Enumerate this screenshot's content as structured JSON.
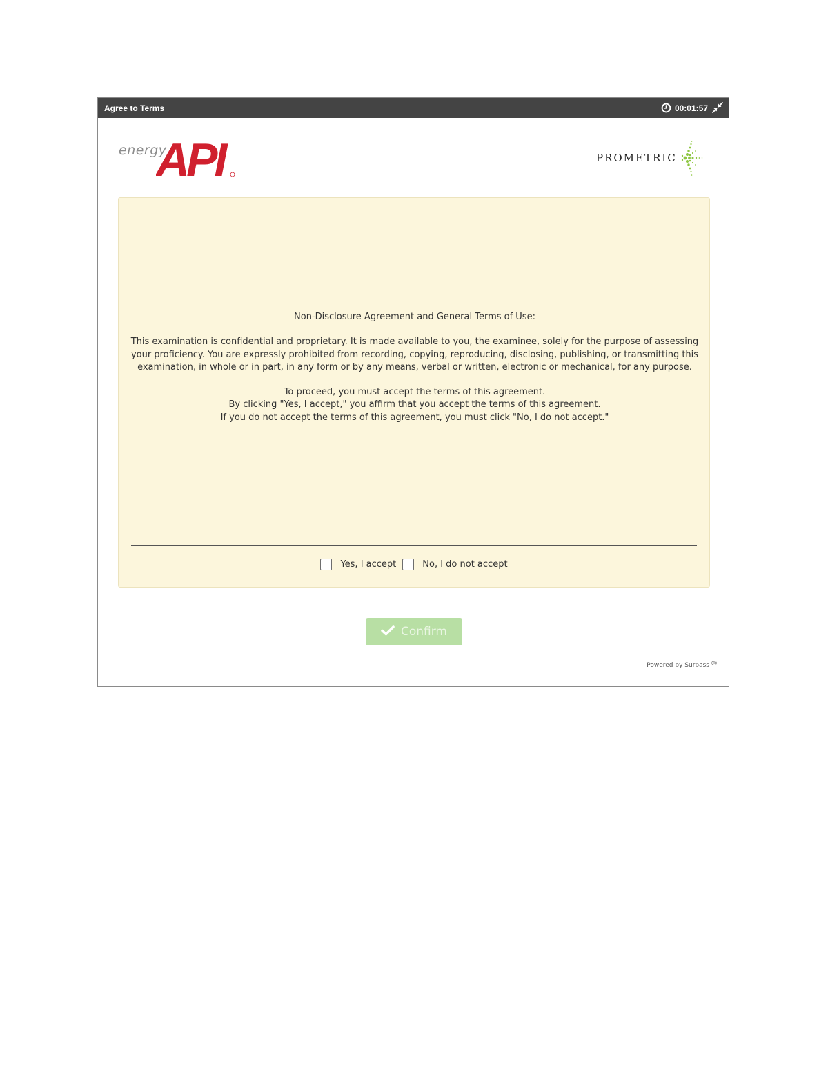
{
  "window": {
    "title": "Agree to Terms",
    "timer": "00:01:57",
    "icons": {
      "timer": "clock-icon",
      "window_control": "shrink-icon"
    }
  },
  "logos": {
    "api_prefix": "energy",
    "api_text": "API",
    "prometric_text": "PROMETRIC"
  },
  "terms": {
    "heading": "Non-Disclosure Agreement and General Terms of Use:",
    "body": "This examination is confidential and proprietary. It is made available to you, the examinee, solely for the purpose of assessing your proficiency. You are expressly prohibited from recording, copying, reproducing, disclosing, publishing, or transmitting this examination, in whole or in part, in any form or by any means, verbal or written, electronic or mechanical, for any purpose.",
    "instruction_1": "To proceed, you must accept the terms of this agreement.",
    "instruction_2": "By clicking \"Yes, I accept,\" you affirm that you accept the terms of this agreement.",
    "instruction_3": "If you do not accept the terms of this agreement, you must click \"No, I do not accept.\""
  },
  "choices": {
    "accept_label": "Yes, I accept",
    "accept_checked": false,
    "decline_label": "No, I do not accept",
    "decline_checked": false
  },
  "confirm": {
    "label": "Confirm",
    "icon": "checkmark-icon",
    "enabled": false
  },
  "footer": {
    "powered_by": "Powered by Surpass",
    "registered_mark": "®"
  },
  "colors": {
    "titlebar": "#444444",
    "panel_background": "#fcf6dc",
    "api_red": "#d0202e",
    "prometric_green": "#8cc63f",
    "confirm_disabled": "#b8dfa4"
  }
}
